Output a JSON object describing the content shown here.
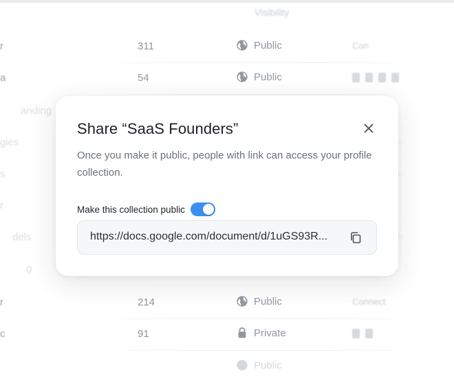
{
  "background_table": {
    "header_visibility": "Visibility",
    "rows": [
      {
        "name": "r",
        "count": "311",
        "visibility": "Public",
        "visibility_icon": "globe-icon",
        "action": "Con"
      },
      {
        "name": "a",
        "count": "54",
        "visibility": "Public",
        "visibility_icon": "globe-icon",
        "action": ""
      },
      {
        "name": "anding",
        "count": "",
        "visibility": "",
        "visibility_icon": "",
        "action": ""
      },
      {
        "name": "gies",
        "count": "",
        "visibility": "",
        "visibility_icon": "",
        "action": "n"
      },
      {
        "name": "s",
        "count": "",
        "visibility": "",
        "visibility_icon": "",
        "action": "n"
      },
      {
        "name": "r",
        "count": "",
        "visibility": "",
        "visibility_icon": "",
        "action": ""
      },
      {
        "name": "dels",
        "count": "",
        "visibility": "",
        "visibility_icon": "",
        "action": "n"
      },
      {
        "name": "g",
        "count": "",
        "visibility": "",
        "visibility_icon": "",
        "action": ""
      },
      {
        "name": "r",
        "count": "214",
        "visibility": "Public",
        "visibility_icon": "globe-icon",
        "action": "Connect"
      },
      {
        "name": "c",
        "count": "91",
        "visibility": "Private",
        "visibility_icon": "lock-icon",
        "action": ""
      },
      {
        "name": "",
        "count": "",
        "visibility": "Public",
        "visibility_icon": "globe-icon",
        "action": ""
      }
    ]
  },
  "modal": {
    "title": "Share “SaaS Founders”",
    "description": "Once you make it public, people with link can access your profile collection.",
    "toggle_label": "Make this collection public",
    "toggle_on": true,
    "link": "https://docs.google.com/document/d/1uGS93R...",
    "icons": {
      "close": "close-icon",
      "copy": "copy-icon"
    },
    "accent_color": "#3b8ff0"
  }
}
